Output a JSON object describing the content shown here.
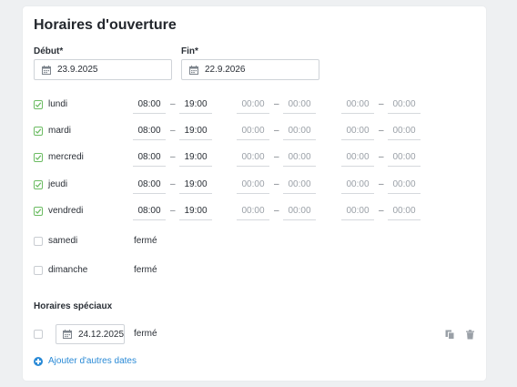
{
  "page": {
    "title": "Horaires d'ouverture",
    "start": {
      "label": "Début*",
      "value": "23.9.2025"
    },
    "end": {
      "label": "Fin*",
      "value": "22.9.2026"
    },
    "days": [
      {
        "name": "lundi",
        "checked": true,
        "slots": [
          [
            "08:00",
            "19:00"
          ],
          [
            "00:00",
            "00:00"
          ],
          [
            "00:00",
            "00:00"
          ]
        ]
      },
      {
        "name": "mardi",
        "checked": true,
        "slots": [
          [
            "08:00",
            "19:00"
          ],
          [
            "00:00",
            "00:00"
          ],
          [
            "00:00",
            "00:00"
          ]
        ]
      },
      {
        "name": "mercredi",
        "checked": true,
        "slots": [
          [
            "08:00",
            "19:00"
          ],
          [
            "00:00",
            "00:00"
          ],
          [
            "00:00",
            "00:00"
          ]
        ]
      },
      {
        "name": "jeudi",
        "checked": true,
        "slots": [
          [
            "08:00",
            "19:00"
          ],
          [
            "00:00",
            "00:00"
          ],
          [
            "00:00",
            "00:00"
          ]
        ]
      },
      {
        "name": "vendredi",
        "checked": true,
        "slots": [
          [
            "08:00",
            "19:00"
          ],
          [
            "00:00",
            "00:00"
          ],
          [
            "00:00",
            "00:00"
          ]
        ]
      },
      {
        "name": "samedi",
        "checked": false,
        "closed": "fermé"
      },
      {
        "name": "dimanche",
        "checked": false,
        "closed": "fermé"
      }
    ],
    "dash": "–",
    "special": {
      "title": "Horaires spéciaux",
      "date": "24.12.2025",
      "closed": "fermé",
      "add_label": "Ajouter d'autres dates"
    },
    "colors": {
      "accent": "#2a8ad6",
      "check": "#6cbc63"
    },
    "icons": {
      "calendar": "calendar-icon",
      "copy": "copy-icon",
      "delete": "trash-icon",
      "add": "plus-circle-icon"
    }
  }
}
